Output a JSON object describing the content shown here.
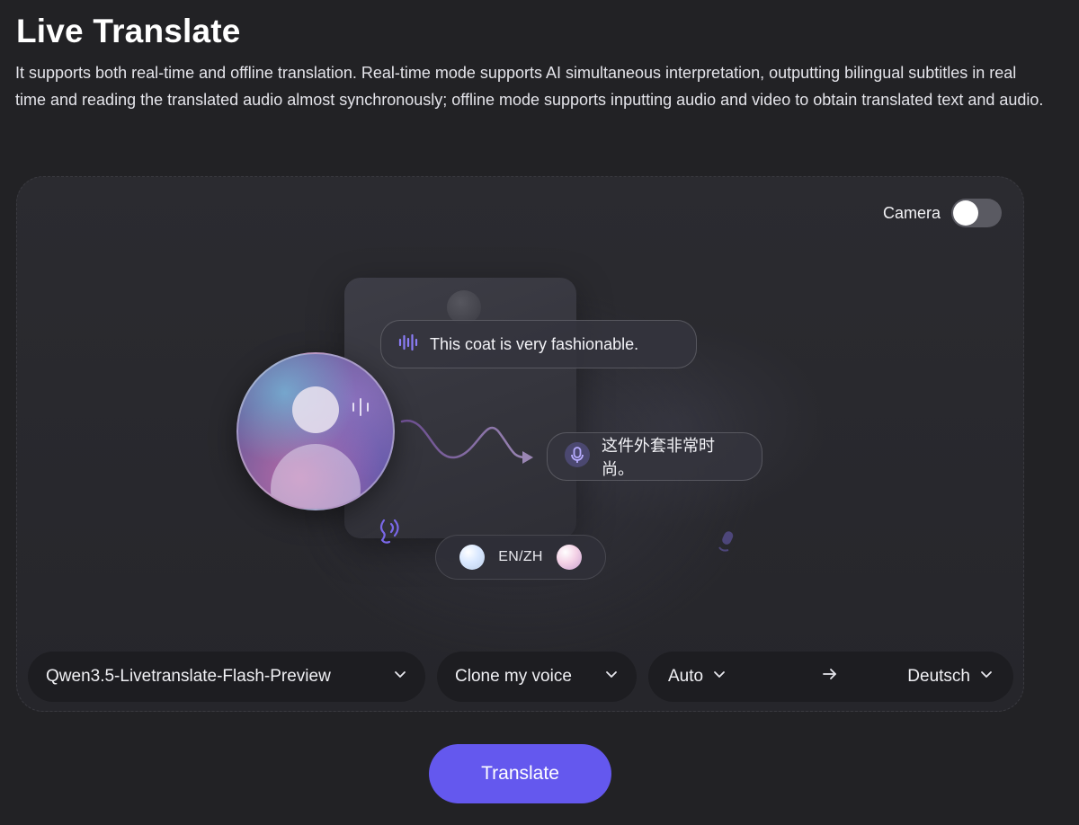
{
  "header": {
    "title": "Live Translate",
    "description": "It supports both real-time and offline translation. Real-time mode supports AI simultaneous interpretation, outputting bilingual subtitles in real time and reading the translated audio almost synchronously; offline mode supports inputting audio and video to obtain translated text and audio."
  },
  "camera": {
    "label": "Camera",
    "enabled": false
  },
  "illustration": {
    "source_bubble": "This coat is very fashionable.",
    "target_bubble": "这件外套非常时尚。",
    "language_pair": "EN/ZH"
  },
  "selectors": {
    "model": "Qwen3.5-Livetranslate-Flash-Preview",
    "voice": "Clone my voice",
    "source_language": "Auto",
    "target_language": "Deutsch"
  },
  "actions": {
    "translate_label": "Translate"
  },
  "colors": {
    "accent": "#6458ee",
    "background": "#222225",
    "stage": "#2b2b30",
    "selector": "#1d1d21",
    "wave_icon": "#8b7cf6"
  },
  "icons": {
    "chevron": "chevron-down-icon",
    "arrow": "arrow-right-icon",
    "audio_wave": "audio-wave-icon",
    "microphone": "microphone-icon",
    "speaking": "speaking-icon"
  }
}
